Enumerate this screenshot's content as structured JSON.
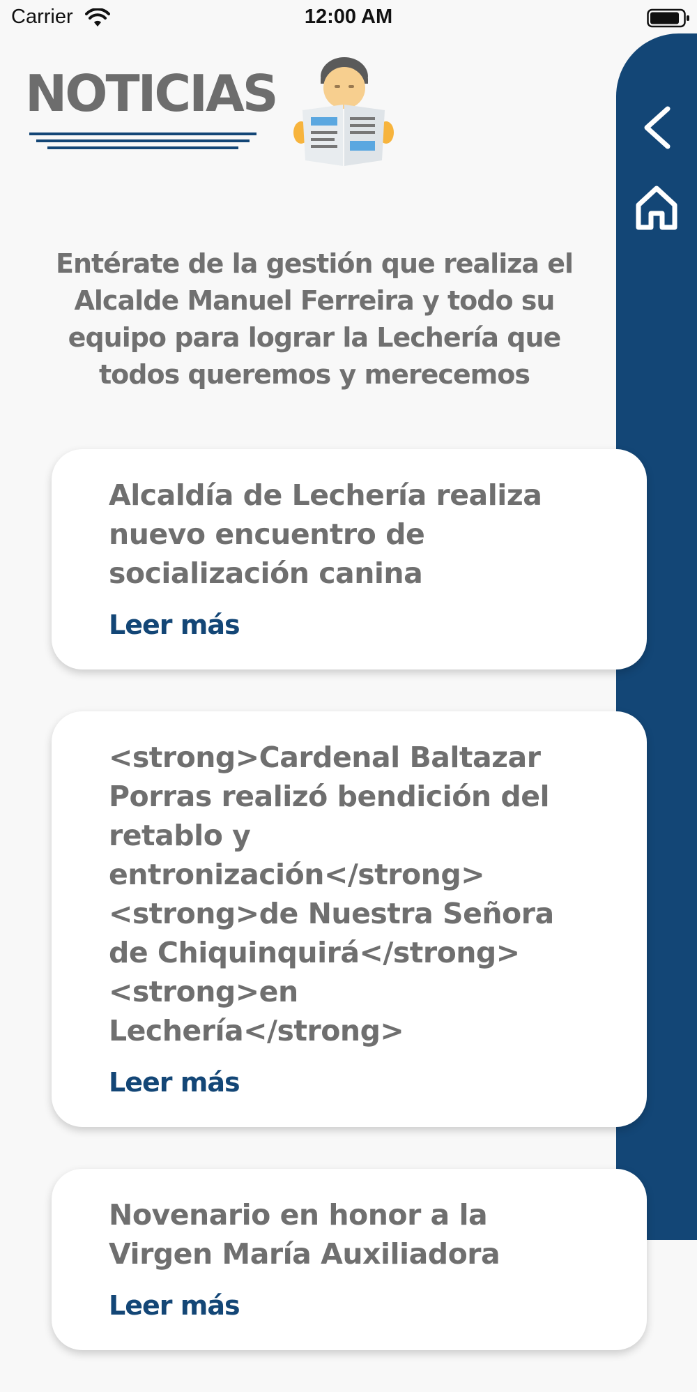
{
  "status_bar": {
    "carrier": "Carrier",
    "time": "12:00 AM",
    "wifi_icon": "wifi-icon",
    "battery_icon": "battery-icon"
  },
  "header": {
    "title": "NOTICIAS",
    "icon": "newspaper-reader-icon"
  },
  "intro": "Entérate de la gestión que realiza el Alcalde Manuel Ferreira y todo su equipo para lograr la Lechería que todos queremos y merecemos",
  "side_nav": {
    "back_icon": "chevron-left-icon",
    "home_icon": "home-icon"
  },
  "news": [
    {
      "title": "Alcaldía de Lechería realiza nuevo encuentro de socialización canina",
      "link_label": "Leer más"
    },
    {
      "title": "<strong>Cardenal Baltazar Porras realizó bendición del retablo y entronización</strong><strong>de Nuestra Señora de Chiquinquirá</strong><strong>en Lechería</strong>",
      "link_label": "Leer más"
    },
    {
      "title": "Novenario en honor a la Virgen María Auxiliadora",
      "link_label": "Leer más"
    }
  ],
  "colors": {
    "accent": "#134676",
    "title_gray": "#6d6d6d",
    "background": "#f8f8f8"
  }
}
